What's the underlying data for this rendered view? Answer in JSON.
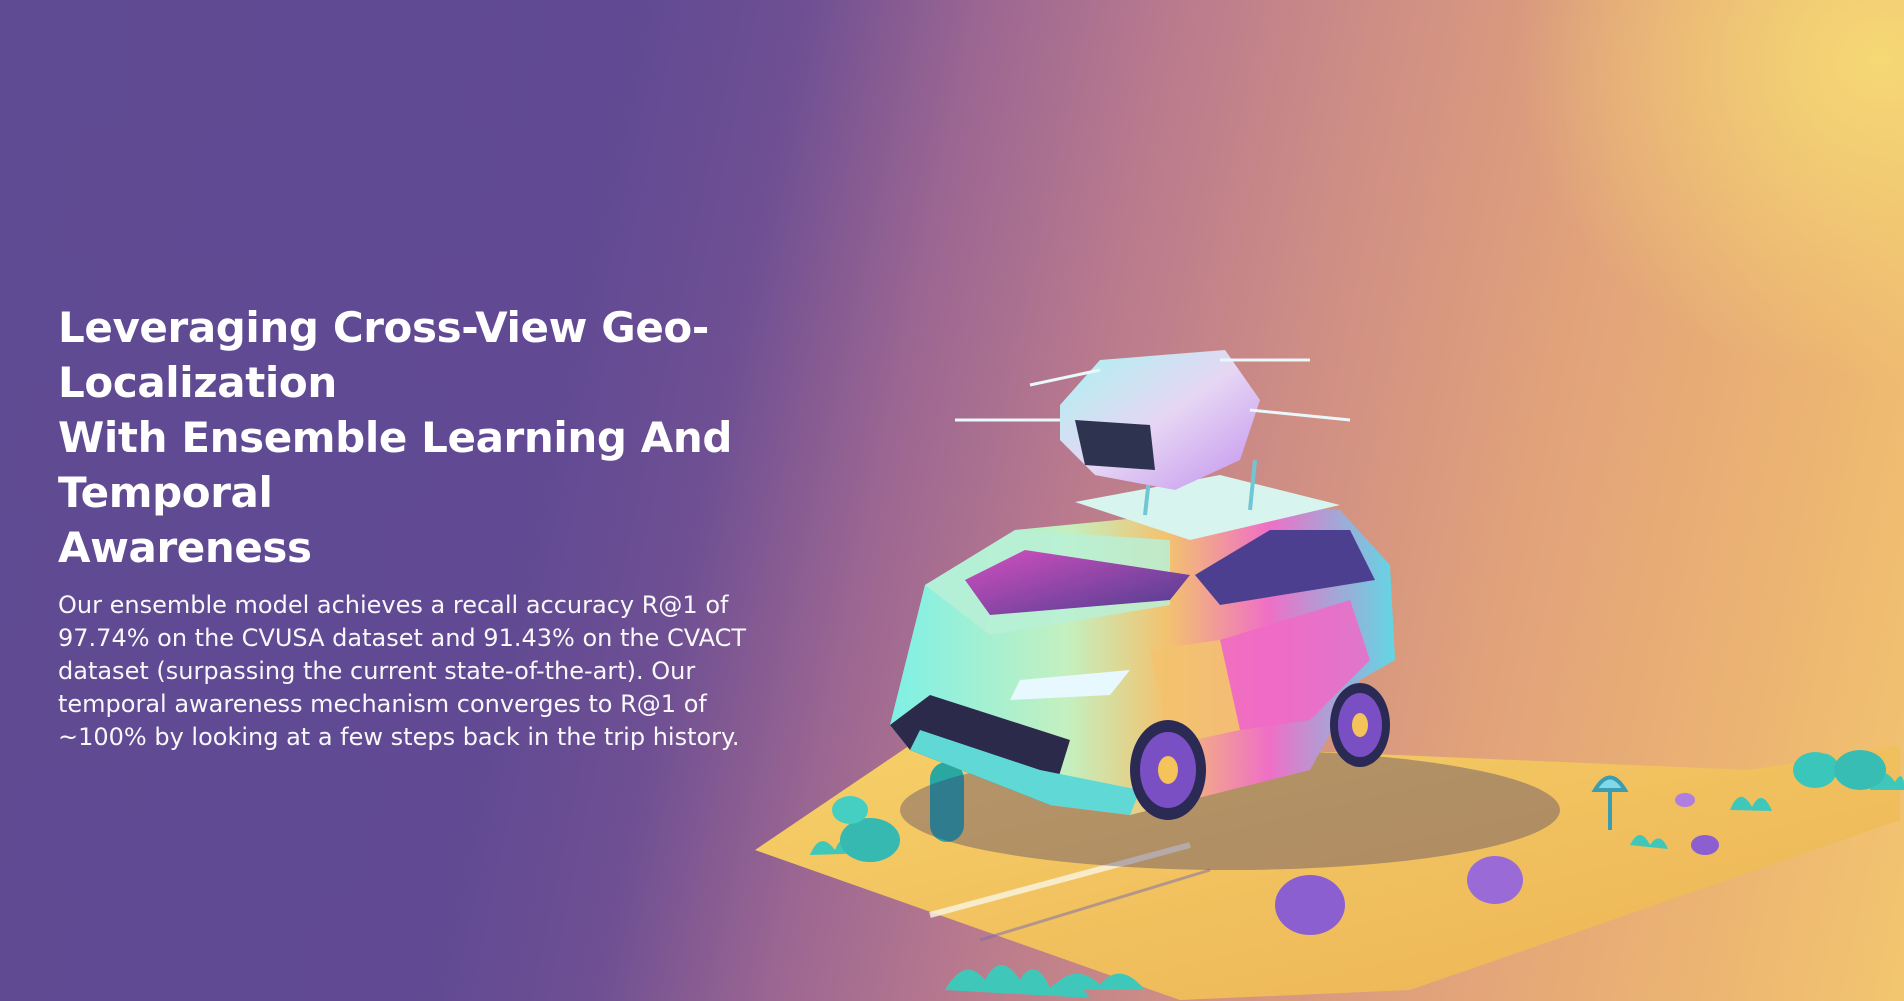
{
  "hero": {
    "title_lines": [
      "Leveraging Cross-View Geo-Localization",
      "With Ensemble Learning And Temporal",
      "Awareness"
    ],
    "description_lines": [
      "Our ensemble model achieves a recall accuracy R@1 of",
      "97.74% on the CVUSA dataset and 91.43% on the CVACT",
      "dataset (surpassing the current state-of-the-art). Our",
      "temporal awareness mechanism converges to R@1 of",
      "~100% by looking at a few steps back in the trip history."
    ]
  },
  "illustration": {
    "subject": "car-with-drone-icon",
    "colors": {
      "ground": "#f2c35c",
      "grass": "#3fc8b9",
      "car_cyan": "#6ee7e0",
      "car_pink": "#ea5ec8",
      "car_yellow": "#f6d978",
      "rock_purple": "#8b5fd0"
    }
  },
  "background": {
    "gradient_stops": [
      "#5f4b93",
      "#b8798e",
      "#e2a37a",
      "#f6da74"
    ]
  }
}
